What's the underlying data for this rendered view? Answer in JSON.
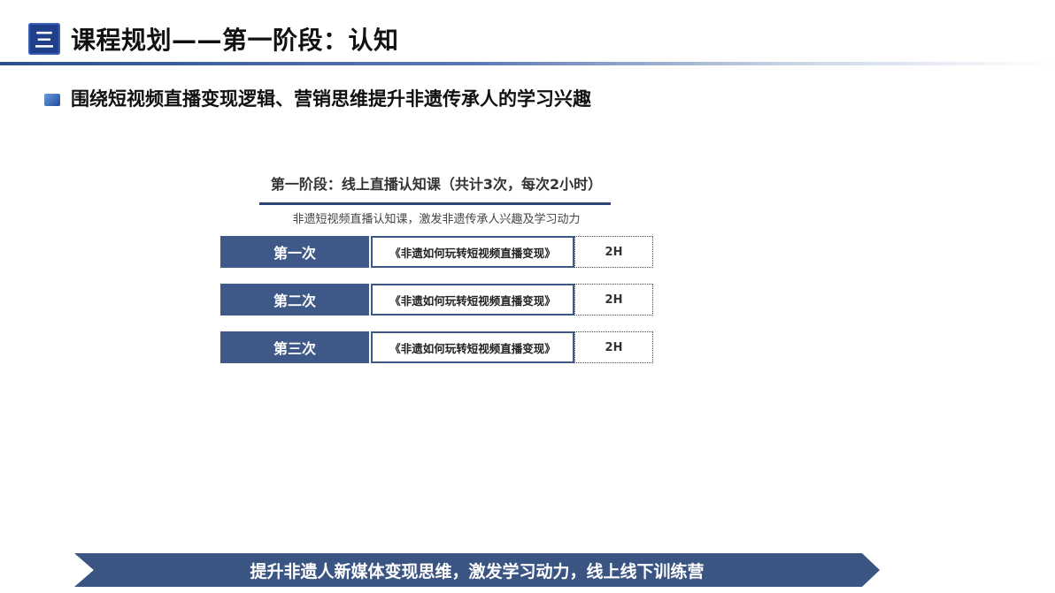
{
  "header": {
    "badge": "三",
    "title": "课程规划——第一阶段：认知"
  },
  "subheading": "围绕短视频直播变现逻辑、营销思维提升非遗传承人的学习兴趣",
  "stage": {
    "title": "第一阶段：线上直播认知课（共计3次，每次2小时）",
    "description": "非遗短视频直播认知课，激发非遗传承人兴趣及学习动力"
  },
  "sessions": [
    {
      "label": "第一次",
      "course": "《非遗如何玩转短视频直播变现》",
      "hours": "2H"
    },
    {
      "label": "第二次",
      "course": "《非遗如何玩转短视频直播变现》",
      "hours": "2H"
    },
    {
      "label": "第三次",
      "course": "《非遗如何玩转短视频直播变现》",
      "hours": "2H"
    }
  ],
  "banner": "提升非遗人新媒体变现思维，激发学习动力，线上线下训练营",
  "colors": {
    "primary": "#3e5987",
    "badge": "#1f3f8a",
    "accent_rule": "#2e4476"
  }
}
